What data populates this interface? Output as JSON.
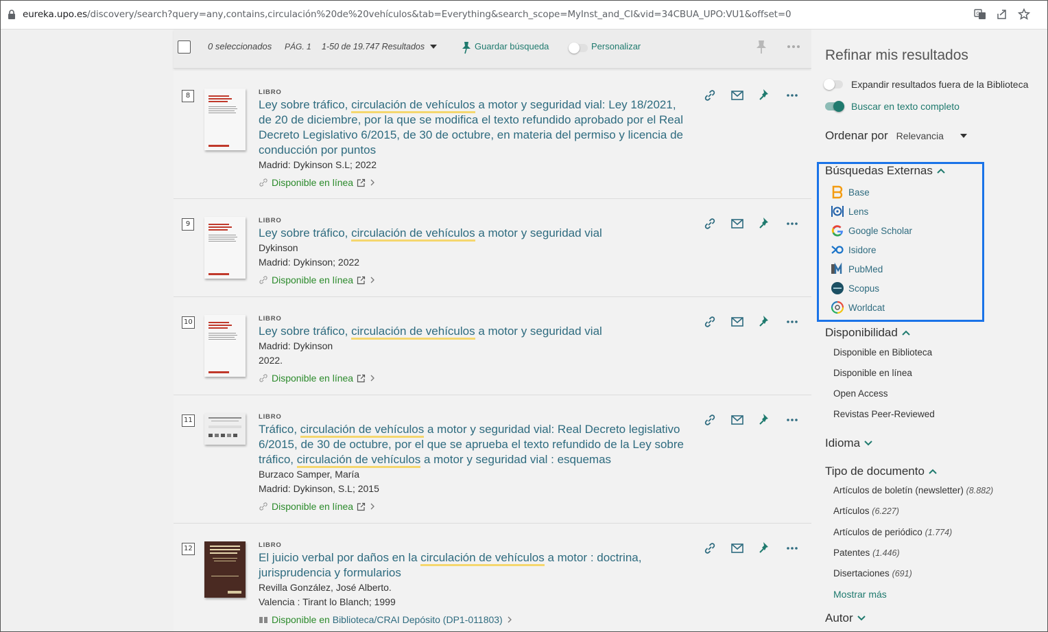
{
  "browser": {
    "url_domain": "eureka.upo.es",
    "url_path": "/discovery/search?query=any,contains,circulación%20de%20vehículos&tab=Everything&search_scope=MyInst_and_CI&vid=34CBUA_UPO:VU1&offset=0"
  },
  "toolbar": {
    "selected": "0 seleccionados",
    "page": "PÁG. 1",
    "range": "1-50 de 19.747 Resultados",
    "save_search": "Guardar búsqueda",
    "personalize": "Personalizar"
  },
  "results": [
    {
      "num": "8",
      "type": "LIBRO",
      "title_pre": "Ley sobre tráfico, ",
      "title_hl": "circulación de vehículos",
      "title_post": " a motor y seguridad vial: Ley 18/2021, de 20 de diciembre, por la que se modifica el texto refundido aprobado por el Real Decreto Legislativo 6/2015, de 30 de octubre, en materia del permiso y licencia de conducción por puntos",
      "meta1": "Madrid: Dykinson S.L; 2022",
      "meta2": "",
      "avail": "Disponible en línea"
    },
    {
      "num": "9",
      "type": "LIBRO",
      "title_pre": "Ley sobre tráfico, ",
      "title_hl": "circulación de vehículos",
      "title_post": " a motor y seguridad vial",
      "meta1": "Dykinson",
      "meta2": "Madrid: Dykinson; 2022",
      "avail": "Disponible en línea"
    },
    {
      "num": "10",
      "type": "LIBRO",
      "title_pre": "Ley sobre tráfico, ",
      "title_hl": "circulación de vehículos",
      "title_post": " a motor y seguridad vial",
      "meta1": "Madrid: Dykinson",
      "meta2": "2022.",
      "avail": "Disponible en línea"
    },
    {
      "num": "11",
      "type": "LIBRO",
      "title_pre": "Tráfico, ",
      "title_hl": "circulación de vehículos",
      "title_mid": " a motor y seguridad vial: Real Decreto legislativo 6/2015, de 30 de octubre, por el que se aprueba el texto refundido de la Ley sobre tráfico, ",
      "title_hl2": "circulación de vehículos",
      "title_post": " a motor y seguridad vial : esquemas",
      "meta1": "Burzaco Samper, María",
      "meta2": "Madrid: Dykinson, S.L; 2015",
      "avail": "Disponible en línea"
    },
    {
      "num": "12",
      "type": "LIBRO",
      "title_pre": "El juicio verbal por daños en la ",
      "title_hl": "circulación de vehículos",
      "title_post": " a motor : doctrina, jurisprudencia y formularios",
      "meta1": "Revilla González, José Alberto.",
      "meta2": "Valencia : Tirant lo Blanch; 1999",
      "avail": "Disponible en ",
      "avail_loc": "Biblioteca/CRAI  Depósito (DP1-011803)"
    }
  ],
  "sidebar": {
    "title": "Refinar mis resultados",
    "expand": "Expandir resultados fuera de la Biblioteca",
    "fulltext": "Buscar en texto completo",
    "sort_label": "Ordenar por",
    "sort_value": "Relevancia",
    "external_title": "Búsquedas Externas",
    "external": [
      "Base",
      "Lens",
      "Google Scholar",
      "Isidore",
      "PubMed",
      "Scopus",
      "Worldcat"
    ],
    "availability_title": "Disponibilidad",
    "availability": [
      "Disponible en Biblioteca",
      "Disponible en línea",
      "Open Access",
      "Revistas Peer-Reviewed"
    ],
    "language_title": "Idioma",
    "doctype_title": "Tipo de documento",
    "doctypes": [
      {
        "label": "Artículos de boletín (newsletter)",
        "count": "(8.882)"
      },
      {
        "label": "Artículos",
        "count": "(6.227)"
      },
      {
        "label": "Artículos de periódico",
        "count": "(1.774)"
      },
      {
        "label": "Patentes",
        "count": "(1.446)"
      },
      {
        "label": "Disertaciones",
        "count": "(691)"
      }
    ],
    "show_more": "Mostrar más",
    "author_title": "Autor"
  },
  "colors": {
    "accent": "#1f7a6e",
    "title": "#2e6b7f",
    "highlight": "#f5d76e",
    "callout": "#1a73e8"
  }
}
